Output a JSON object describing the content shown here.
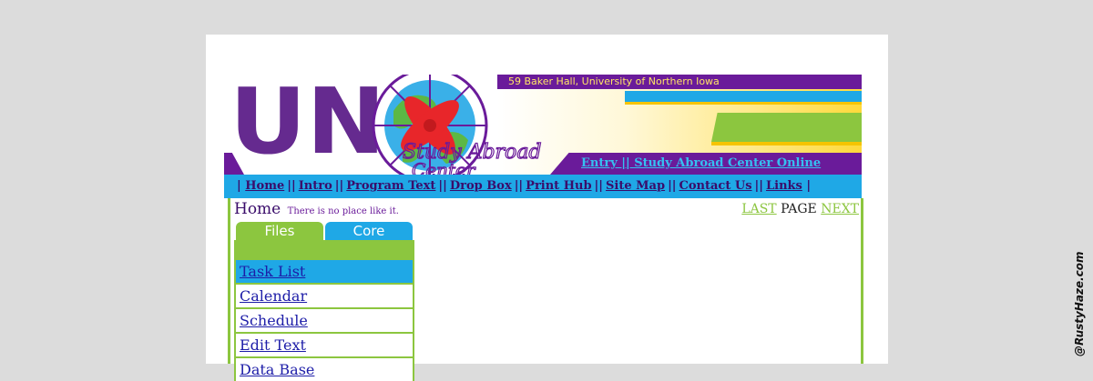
{
  "banner": {
    "logo_text": "UNI",
    "logo_subtitle_1": "Study Abroad",
    "logo_subtitle_2": "Center",
    "address": "59 Baker Hall, University of Northern Iowa",
    "entry_link": "Entry || Study Abroad Center Online"
  },
  "nav": {
    "items": [
      "Home",
      "Intro",
      "Program Text",
      "Drop Box",
      "Print Hub",
      "Site Map",
      "Contact Us",
      "Links"
    ]
  },
  "content": {
    "title": "Home",
    "tagline": "There is no place like it.",
    "pager": {
      "last": "LAST",
      "page": "PAGE",
      "next": "NEXT"
    },
    "tabs": [
      "Files",
      "Core"
    ],
    "menu": [
      "Task List",
      "Calendar",
      "Schedule",
      "Edit Text",
      "Data Base"
    ],
    "active_index": 0
  },
  "watermark": "@RustyHaze.com",
  "colors": {
    "purple": "#6a1b9a",
    "blue": "#1fa8e6",
    "green": "#8cc63f",
    "red": "#e8262a"
  }
}
